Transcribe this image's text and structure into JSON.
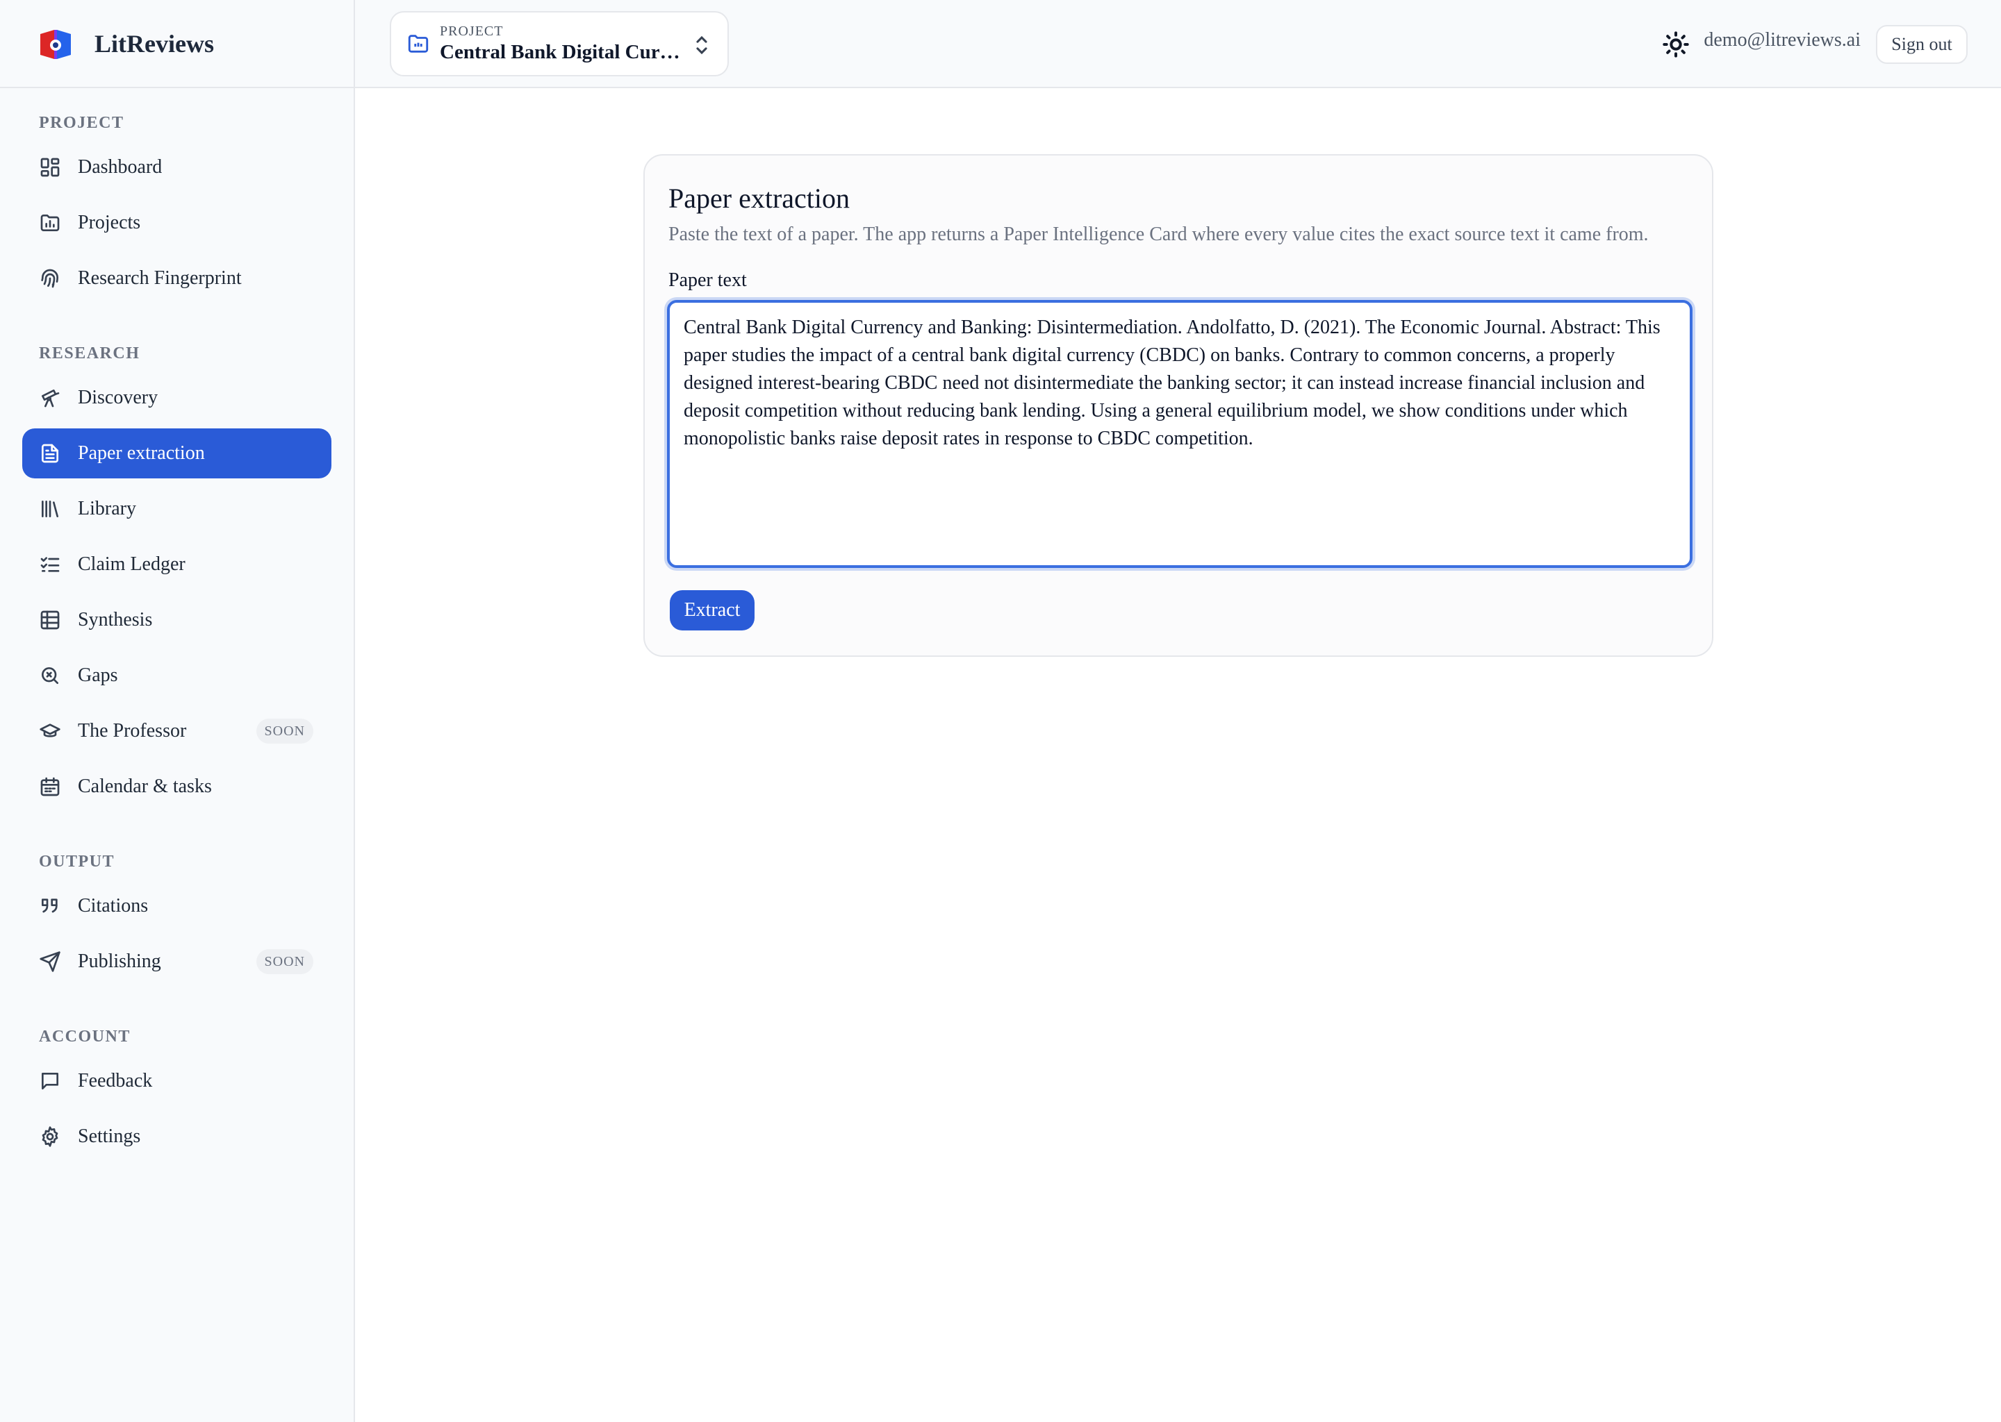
{
  "brand": {
    "name": "LitReviews"
  },
  "topbar": {
    "project_label": "PROJECT",
    "project_name": "Central Bank Digital Currency and Banking",
    "user_email": "demo@litreviews.ai",
    "signout_label": "Sign out"
  },
  "sidebar": {
    "sections": [
      {
        "label": "PROJECT",
        "items": [
          {
            "label": "Dashboard",
            "icon": "dashboard-icon"
          },
          {
            "label": "Projects",
            "icon": "folder-chart-icon"
          },
          {
            "label": "Research Fingerprint",
            "icon": "fingerprint-icon"
          }
        ]
      },
      {
        "label": "RESEARCH",
        "items": [
          {
            "label": "Discovery",
            "icon": "telescope-icon"
          },
          {
            "label": "Paper extraction",
            "icon": "document-icon",
            "active": true
          },
          {
            "label": "Library",
            "icon": "library-icon"
          },
          {
            "label": "Claim Ledger",
            "icon": "checklist-icon"
          },
          {
            "label": "Synthesis",
            "icon": "grid-table-icon"
          },
          {
            "label": "Gaps",
            "icon": "search-x-icon"
          },
          {
            "label": "The Professor",
            "icon": "graduation-cap-icon",
            "badge": "SOON"
          },
          {
            "label": "Calendar & tasks",
            "icon": "calendar-icon"
          }
        ]
      },
      {
        "label": "OUTPUT",
        "items": [
          {
            "label": "Citations",
            "icon": "quote-icon"
          },
          {
            "label": "Publishing",
            "icon": "send-icon",
            "badge": "SOON"
          }
        ]
      },
      {
        "label": "ACCOUNT",
        "items": [
          {
            "label": "Feedback",
            "icon": "message-icon"
          },
          {
            "label": "Settings",
            "icon": "gear-icon"
          }
        ]
      }
    ]
  },
  "main": {
    "title": "Paper extraction",
    "description": "Paste the text of a paper. The app returns a Paper Intelligence Card where every value cites the exact source text it came from.",
    "field_label": "Paper text",
    "paper_text": "Central Bank Digital Currency and Banking: Disintermediation. Andolfatto, D. (2021). The Economic Journal. Abstract: This paper studies the impact of a central bank digital currency (CBDC) on banks. Contrary to common concerns, a properly designed interest-bearing CBDC need not disintermediate the banking sector; it can instead increase financial inclusion and deposit competition without reducing bank lending. Using a general equilibrium model, we show conditions under which monopolistic banks raise deposit rates in response to CBDC competition.",
    "extract_label": "Extract"
  },
  "colors": {
    "accent": "#2a5bd7",
    "sidebar_bg": "#f8fafc",
    "border": "#e5e7eb"
  }
}
